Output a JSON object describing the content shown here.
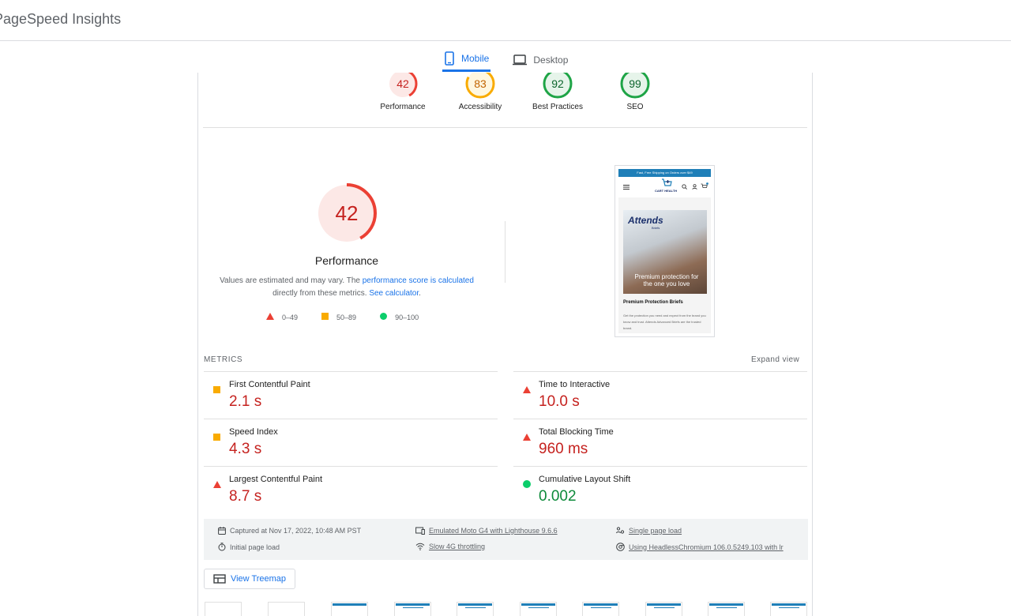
{
  "app": {
    "title": "PageSpeed Insights"
  },
  "tabs": [
    {
      "label": "Mobile",
      "active": true
    },
    {
      "label": "Desktop",
      "active": false
    }
  ],
  "summary_scores": [
    {
      "label": "Performance",
      "score": "42",
      "color": "#eb4034"
    },
    {
      "label": "Accessibility",
      "score": "83",
      "color": "#f9ab00"
    },
    {
      "label": "Best Practices",
      "score": "92",
      "color": "#1ea446"
    },
    {
      "label": "SEO",
      "score": "99",
      "color": "#1ea446"
    }
  ],
  "performance": {
    "score": "42",
    "title": "Performance",
    "desc_prefix": "Values are estimated and may vary. The ",
    "desc_link1": "performance score is calculated",
    "desc_mid": " directly from these metrics. ",
    "desc_link2": "See calculator",
    "desc_suffix": "."
  },
  "legend": [
    {
      "label": "0–49",
      "color": "#eb4034",
      "shape": "triangle"
    },
    {
      "label": "50–89",
      "color": "#f9ab00",
      "shape": "square"
    },
    {
      "label": "90–100",
      "color": "#0cce6b",
      "shape": "circle"
    }
  ],
  "screenshot": {
    "banner": "Fast, Free Shipping on Orders over $49",
    "logo_text": "CART HEALTH",
    "brand": "Attends",
    "brand_sub": "Briefs",
    "caption": "Premium protection for the one you love",
    "product_title": "Premium Protection Briefs",
    "product_desc": "Get the protection you need and expect from the brand you know and trust. Attends Advanced Briefs are the trusted brand."
  },
  "metrics_header": "METRICS",
  "expand_label": "Expand view",
  "metrics": [
    {
      "name": "First Contentful Paint",
      "value": "2.1 s",
      "rating": "average"
    },
    {
      "name": "Time to Interactive",
      "value": "10.0 s",
      "rating": "poor"
    },
    {
      "name": "Speed Index",
      "value": "4.3 s",
      "rating": "average"
    },
    {
      "name": "Total Blocking Time",
      "value": "960 ms",
      "rating": "poor"
    },
    {
      "name": "Largest Contentful Paint",
      "value": "8.7 s",
      "rating": "poor"
    },
    {
      "name": "Cumulative Layout Shift",
      "value": "0.002",
      "rating": "good"
    }
  ],
  "run_info": {
    "captured": "Captured at Nov 17, 2022, 10:48 AM PST",
    "initial": "Initial page load",
    "device": "Emulated Moto G4 with Lighthouse 9.6.6",
    "network": "Slow 4G throttling",
    "session": "Single page load",
    "browser": "Using HeadlessChromium 106.0.5249.103 with lr"
  },
  "treemap_label": "View Treemap",
  "colors": {
    "poor": "#eb4034",
    "average": "#f9ab00",
    "good": "#0cce6b",
    "accent": "#1a73e8"
  }
}
